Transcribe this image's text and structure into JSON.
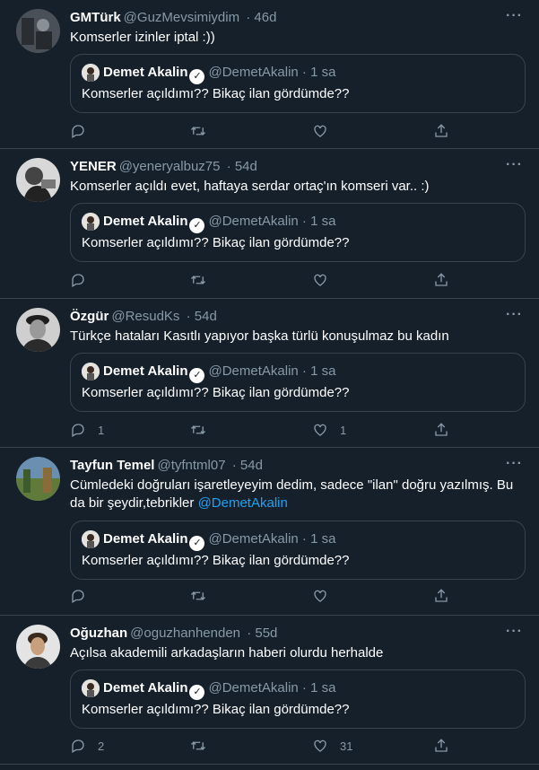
{
  "quoted": {
    "name": "Demet Akalin",
    "handle": "@DemetAkalin",
    "time": "· 1 sa",
    "text": "Komserler açıldımı?? Bikaç ilan gördümde??"
  },
  "tweets": [
    {
      "name": "GMTürk",
      "handle": "@GuzMevsimiydim",
      "time": "· 46d",
      "text": "Komserler izinler iptal :))",
      "mention": "",
      "reply_count": "",
      "like_count": ""
    },
    {
      "name": "YENER",
      "handle": "@yeneryalbuz75",
      "time": "· 54d",
      "text": "Komserler açıldı evet, haftaya serdar ortaç'ın komseri var.. :)",
      "mention": "",
      "reply_count": "",
      "like_count": ""
    },
    {
      "name": "Özgür",
      "handle": "@ResudKs",
      "time": "· 54d",
      "text": "Türkçe hataları Kasıtlı yapıyor başka türlü konuşulmaz bu kadın",
      "mention": "",
      "reply_count": "1",
      "like_count": "1"
    },
    {
      "name": "Tayfun Temel",
      "handle": "@tyfntml07",
      "time": "· 54d",
      "text": "Cümledeki doğruları işaretleyeyim dedim, sadece \"ilan\" doğru yazılmış. Bu da bir şeydir,tebrikler ",
      "mention": "@DemetAkalin",
      "reply_count": "",
      "like_count": ""
    },
    {
      "name": "Oğuzhan",
      "handle": "@oguzhanhenden",
      "time": "· 55d",
      "text": "Açılsa akademili arkadaşların haberi olurdu herhalde",
      "mention": "",
      "reply_count": "2",
      "like_count": "31"
    }
  ],
  "icons": {
    "more": "more-horizontal-icon",
    "reply": "reply-icon",
    "retweet": "retweet-icon",
    "like": "heart-icon",
    "share": "share-icon",
    "verified": "verified-badge-icon"
  },
  "colors": {
    "background": "#15202b",
    "border": "#38444d",
    "muted": "#8899a6",
    "accent": "#1da1f2"
  }
}
